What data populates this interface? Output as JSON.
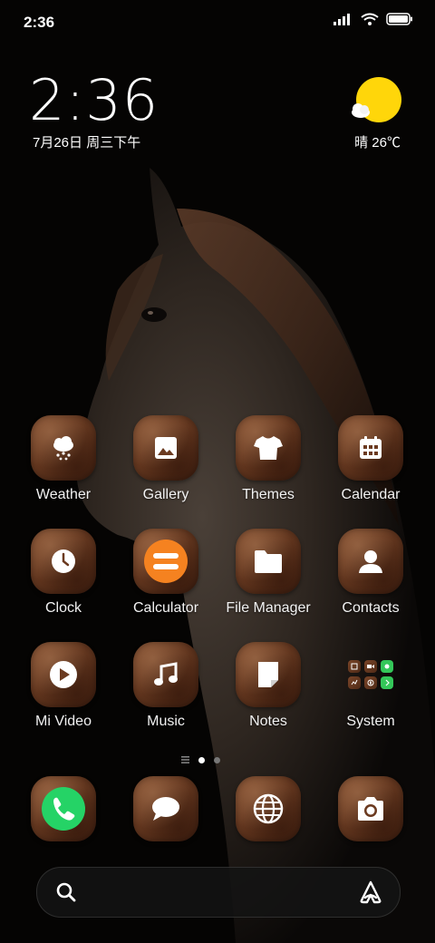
{
  "status_bar": {
    "time": "2:36",
    "icons": [
      "signal-icon",
      "wifi-icon",
      "battery-icon"
    ]
  },
  "clock_widget": {
    "time": "2:36",
    "date": "7月26日 周三下午"
  },
  "weather_widget": {
    "condition": "晴",
    "temperature": "26℃",
    "text": "晴 26℃",
    "icon": "sunny-icon",
    "sun_color": "#FFD60A"
  },
  "apps": [
    {
      "label": "Weather",
      "icon": "weather-icon"
    },
    {
      "label": "Gallery",
      "icon": "gallery-icon"
    },
    {
      "label": "Themes",
      "icon": "tshirt-icon"
    },
    {
      "label": "Calendar",
      "icon": "calendar-icon"
    },
    {
      "label": "Clock",
      "icon": "clock-icon"
    },
    {
      "label": "Calculator",
      "icon": "calculator-icon"
    },
    {
      "label": "File Manager",
      "icon": "folder-icon"
    },
    {
      "label": "Contacts",
      "icon": "contact-icon"
    },
    {
      "label": "Mi Video",
      "icon": "play-icon"
    },
    {
      "label": "Music",
      "icon": "music-note-icon"
    },
    {
      "label": "Notes",
      "icon": "note-icon"
    },
    {
      "label": "System",
      "icon": "folder-grid-icon"
    }
  ],
  "dock": [
    {
      "icon": "phone-icon",
      "accent": "#25D366"
    },
    {
      "icon": "message-icon"
    },
    {
      "icon": "browser-globe-icon"
    },
    {
      "icon": "camera-icon"
    }
  ],
  "page_indicator": {
    "pages": 3,
    "current": 1
  },
  "search_bar": {
    "left_icon": "search-icon",
    "right_icon": "assistant-icon"
  },
  "colors": {
    "icon_brown": "#6B3A20",
    "calculator_orange": "#F58220",
    "phone_green": "#25D366"
  }
}
